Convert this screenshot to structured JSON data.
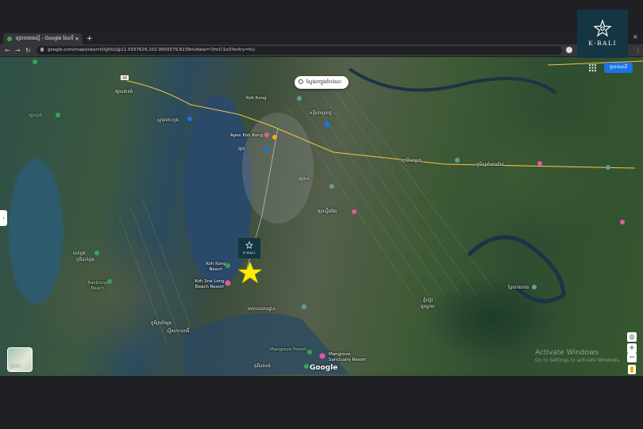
{
  "browser": {
    "tab_title": "ជ្រោយរោងស្មី - Google ផែនទី",
    "close_tab": "×",
    "new_tab": "+",
    "url": "google.com/maps/search/ជ្រោយ/@11.5937629,102.9950579,8239m/data=!3m1!1e3?entry=ttu",
    "back": "←",
    "forward": "→",
    "reload": "↻",
    "menu": "⋮",
    "window_close": "×"
  },
  "brand": {
    "name": "K·BALI",
    "badge_name": "K·BALI",
    "color": "#163543"
  },
  "map": {
    "search_area_label": "ស្វែងរកក្នុងតំបន់នេះ",
    "signin_label": "ចូលគណនី",
    "side_toggle": "›",
    "layers_label": "ស្រទាប់",
    "zoom_in": "+",
    "zoom_out": "−",
    "compass": "◎",
    "watermark": "Google",
    "activate_title": "Activate Windows",
    "activate_sub": "Go to Settings to activate Windows.",
    "highlight_color": "#ffeb00",
    "places": {
      "koh_kong": "Koh Kong",
      "apex": "Apex Koh Kong",
      "koh_kong_beach": "Koh Kong Beach",
      "koh_sne_long": "Koh Sne Long Beach Resort",
      "mangrove_forest": "Mangrove Forest",
      "mangrove_sanctuary": "Mangrove Sanctuary Resort",
      "bakklong_beach": "Bakklong Beach",
      "route_48": "48"
    },
    "km_labels": {
      "k1": "ផ្សារដងទង់",
      "k2": "ស្ពានកោះកុង",
      "k3": "មន្ទីរពេទ្យខេត្ត",
      "k4": "ផ្សារ",
      "k5": "ស្ថានីយប្រេង",
      "k6": "ភូមិស្មាច់មានជ័យ",
      "k7": "ឆ្នេរខ្សាច់",
      "k8": "បាក់ក្លង",
      "k9": "ភូមិបាក់ក្លង",
      "k10": "ផ្សារស្ទឹងវែង",
      "k11": "វត្តនាគ",
      "k12": "ភ្នំខៀវ",
      "k13": "អូរស្វាយ",
      "k14": "ព្រៃកោងកាង",
      "k15": "ភូមិត្រពាំងរូង",
      "k16": "ស្ទឹងកោះពោធិ៍",
      "k17": "អាកាសយានដ្ឋាន",
      "k18": "ភូមិដងទង់"
    }
  }
}
